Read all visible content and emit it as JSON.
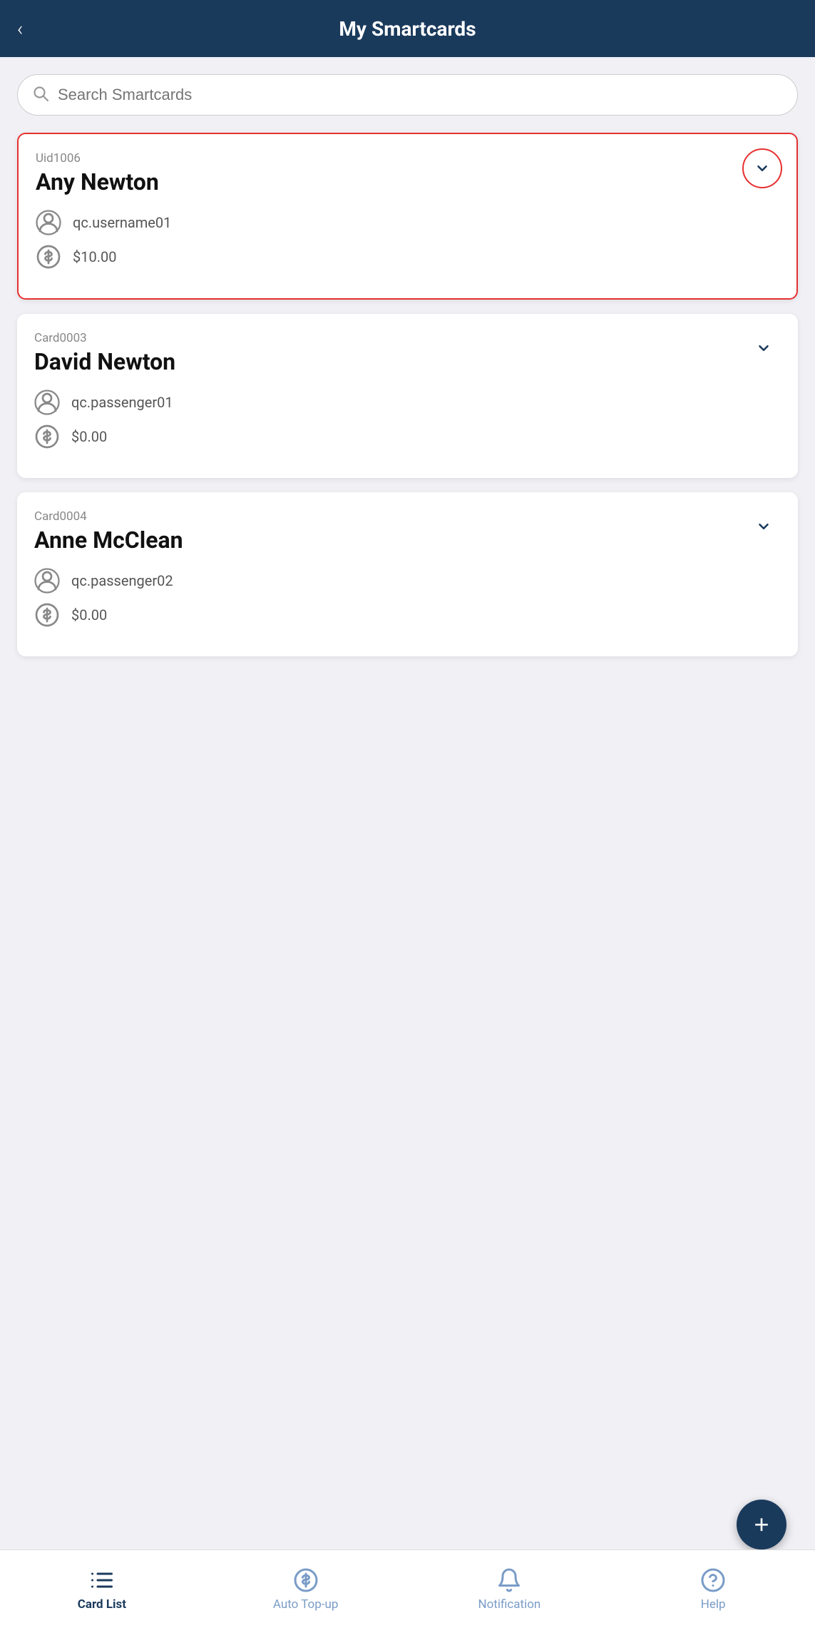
{
  "header": {
    "title": "My Smartcards",
    "back_label": "‹"
  },
  "search": {
    "placeholder": "Search Smartcards"
  },
  "cards": [
    {
      "id": "Uid1006",
      "name": "Any Newton",
      "username": "qc.username01",
      "balance": "$10.00",
      "highlighted": true
    },
    {
      "id": "Card0003",
      "name": "David Newton",
      "username": "qc.passenger01",
      "balance": "$0.00",
      "highlighted": false
    },
    {
      "id": "Card0004",
      "name": "Anne McClean",
      "username": "qc.passenger02",
      "balance": "$0.00",
      "highlighted": false
    }
  ],
  "fab": {
    "label": "+"
  },
  "bottom_nav": {
    "items": [
      {
        "key": "card-list",
        "label": "Card List",
        "active": true
      },
      {
        "key": "auto-topup",
        "label": "Auto Top-up",
        "active": false
      },
      {
        "key": "notification",
        "label": "Notification",
        "active": false
      },
      {
        "key": "help",
        "label": "Help",
        "active": false
      }
    ]
  }
}
